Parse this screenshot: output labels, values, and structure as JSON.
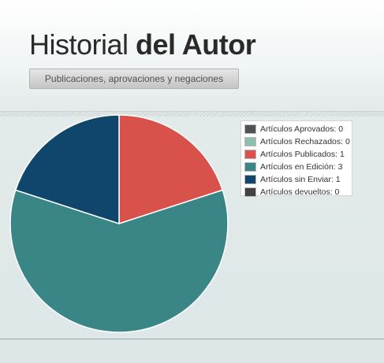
{
  "header": {
    "title_light": "Historial",
    "title_bold": "del Autor",
    "subtitle_button": "Publicaciones, aprovaciones y negaciones"
  },
  "chart_data": {
    "type": "pie",
    "series": [
      {
        "name": "Artículos Aprovados",
        "value": 0,
        "color": "#4c5455"
      },
      {
        "name": "Artículos Rechazados",
        "value": 0,
        "color": "#8cbfae"
      },
      {
        "name": "Artículos Publicados",
        "value": 1,
        "color": "#d9514b"
      },
      {
        "name": "Artículos en Edición",
        "value": 3,
        "color": "#3a8585"
      },
      {
        "name": "Artículos sin Enviar",
        "value": 1,
        "color": "#10466b"
      },
      {
        "name": "Artículos devueltos",
        "value": 0,
        "color": "#424242"
      }
    ],
    "legend_position": "top-right",
    "legend_labels": [
      "Artículos Aprovados: 0",
      "Artículos Rechazados: 0",
      "Artículos Publicados: 1",
      "Artículos en Edición: 3",
      "Artículos sin Enviar: 1",
      "Artículos devueltos: 0"
    ]
  }
}
